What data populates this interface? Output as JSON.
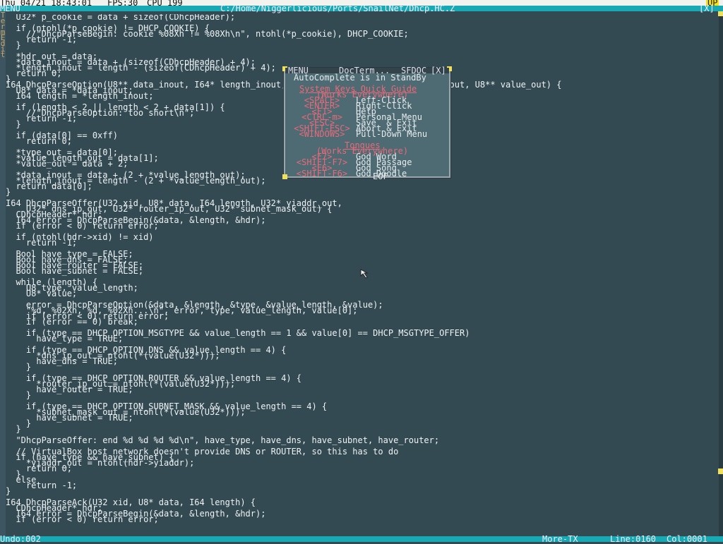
{
  "topbar": {
    "menu": "MENU",
    "datetime": "Thu 04/21 18:43:01",
    "fps": "FPS:30",
    "cpu": "CPU  199",
    "up": "UP"
  },
  "titlebar": {
    "path": "C:/Home/Niggerlicious/Ports/SnailNet/Dhcp.HC.Z",
    "close": "[X]"
  },
  "left_strip_text": "Term Edit",
  "code_lines": [
    "  U32* p_cookie = data + sizeof(CDhcpHeader);",
    "",
    "  if (ntohl(*p_cookie) != DHCP_COOKIE) {",
    "    //\"DhcpParseBegin: cookie %08Xh != %08Xh\\n\", ntohl(*p_cookie), DHCP_COOKIE;",
    "    return -1;",
    "  }",
    "",
    "  *hdr_out = data;",
    "  *data_inout = data + (sizeof(CDhcpHeader) + 4);",
    "  *length_inout = length - (sizeof(CDhcpHeader) + 4);",
    "  return 0;",
    "}",
    "I64 DhcpParseOption(U8** data_inout, I64* length_inout, U8* type_out, U8* value_length_out, U8** value_out) {",
    "  U8* data = *data_inout;",
    "  I64 length = *length_inout;",
    "",
    "  if (length < 2 || length < 2 + data[1]) {",
    "    //\"DhcpParseOption: too short\\n\";",
    "    return -1;",
    "  }",
    "",
    "  if (data[0] == 0xff)",
    "    return 0;",
    "",
    "  *type_out = data[0];",
    "  *value_length_out = data[1];",
    "  *value_out = data + 2;",
    "",
    "  *data_inout = data + (2 + *value_length_out);",
    "  *length_inout = length - (2 + *value_length_out);",
    "  return data[0];",
    "}",
    "",
    "I64 DhcpParseOffer(U32 xid, U8* data, I64 length, U32* yiaddr_out,",
    "    U32* dns_ip_out, U32* router_ip_out, U32* subnet_mask_out) {",
    "  CDhcpHeader* hdr;",
    "  I64 error = DhcpParseBegin(&data, &length, &hdr);",
    "  if (error < 0) return error;",
    "",
    "  if (ntohl(hdr->xid) != xid)",
    "    return -1;",
    "",
    "  Bool have_type = FALSE;",
    "  Bool have_dns = FALSE;",
    "  Bool have_router = FALSE;",
    "  Bool have_subnet = FALSE;",
    "",
    "  while (length) {",
    "    U8 type, value_length;",
    "    U8* value;",
    "",
    "    error = DhcpParseOption(&data, &length, &type, &value_length, &value);",
    "    \"%d, %02Xh, %d, %02Xh...\\n\", error, type, value_length, value[0];",
    "    if (error < 0) return error;",
    "    if (error == 0) break;",
    "",
    "    if (type == DHCP_OPTION_MSGTYPE && value_length == 1 && value[0] == DHCP_MSGTYPE_OFFER)",
    "      have_type = TRUE;",
    "",
    "    if (type == DHCP_OPTION_DNS && value_length == 4) {",
    "      *dns_ip_out = ntohl(*(value(U32*)));",
    "      have_dns = TRUE;",
    "    }",
    "",
    "    if (type == DHCP_OPTION_ROUTER && value_length == 4) {",
    "      *router_ip_out = ntohl(*(value(U32*)));",
    "      have_router = TRUE;",
    "    }",
    "",
    "    if (type == DHCP_OPTION_SUBNET_MASK && value_length == 4) {",
    "      *subnet_mask_out = ntohl(*(value(U32*)));",
    "      have_subnet = TRUE;",
    "    }",
    "  }",
    "",
    "  \"DhcpParseOffer: end %d %d %d %d\\n\", have_type, have_dns, have_subnet, have_router;",
    "",
    "  // VirtualBox host network doesn't provide DNS or ROUTER, so this has to do",
    "  if (have_type && have_subnet) {",
    "    *yiaddr_out = ntohl(hdr->yiaddr);",
    "    return 0;",
    "  }",
    "  else",
    "    return -1;",
    "}",
    "",
    "I64 DhcpParseAck(U32 xid, U8* data, I64 length) {",
    "  CDhcpHeader* hdr;",
    "  I64 error = DhcpParseBegin(&data, &length, &hdr);",
    "  if (error < 0) return error;"
  ],
  "popup": {
    "title_menu": "MENU",
    "title_name": "DocTerm...",
    "title_right": "SFDOC",
    "title_close": "[X]",
    "standby": "AutoComplete is in StandBy",
    "heading1": "System Keys Quick Guide",
    "heading1_sub": "(Works Everywhere)",
    "keys": [
      {
        "key": "<SPACE>",
        "action": "Left-Click"
      },
      {
        "key": "<ENTER>",
        "action": "Right-Click"
      },
      {
        "key": "<F1>",
        "action": "Help"
      },
      {
        "key": "<CTRL-m>",
        "action": "Personal Menu"
      },
      {
        "key": "<ESC>",
        "action": "Save  & Exit"
      },
      {
        "key": "<SHIFT-ESC>",
        "action": "Abort & Exit"
      },
      {
        "key": "<WINDOWS>",
        "action": "Pull-Down Menu"
      }
    ],
    "heading2": "Tongues",
    "heading2_sub": "(Works Everywhere)",
    "tongues": [
      {
        "key": "<F7>",
        "action": "God Word"
      },
      {
        "key": "<SHIFT-F7>",
        "action": "God Passage"
      },
      {
        "key": "<F6>",
        "action": "God Song"
      },
      {
        "key": "<SHIFT-F6>",
        "action": "God Doodle"
      }
    ],
    "eof": "EOF"
  },
  "status": {
    "undo": "Undo:002",
    "mode": "More-TX",
    "line": "Line:0160",
    "col": "Col:0001"
  },
  "colors": {
    "background": "#344a52",
    "title_bar": "#17a9b4",
    "string": "#e2c08a",
    "heading": "#e86a7a"
  }
}
